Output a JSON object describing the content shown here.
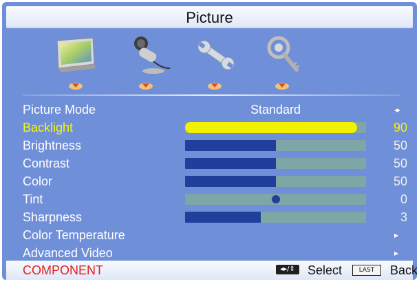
{
  "header": {
    "title": "Picture"
  },
  "menu_icons": [
    {
      "name": "picture-tv-icon"
    },
    {
      "name": "audio-microphone-icon"
    },
    {
      "name": "settings-wrench-icon"
    },
    {
      "name": "lock-key-icon"
    }
  ],
  "rows": [
    {
      "label": "Picture Mode",
      "kind": "option",
      "value": "Standard",
      "indicator": "◂▸"
    },
    {
      "label": "Backlight",
      "kind": "slider",
      "value": "90",
      "level": 0.95,
      "selected": true
    },
    {
      "label": "Brightness",
      "kind": "slider",
      "value": "50",
      "level": 0.5
    },
    {
      "label": "Contrast",
      "kind": "slider",
      "value": "50",
      "level": 0.5
    },
    {
      "label": "Color",
      "kind": "slider",
      "value": "50",
      "level": 0.5
    },
    {
      "label": "Tint",
      "kind": "center-slider",
      "value": "0",
      "level": 0.5
    },
    {
      "label": "Sharpness",
      "kind": "slider",
      "value": "3",
      "level": 0.42
    },
    {
      "label": "Color Temperature",
      "kind": "submenu",
      "indicator": "▸"
    },
    {
      "label": "Advanced Video",
      "kind": "submenu",
      "indicator": "▸"
    }
  ],
  "footer": {
    "source": "COMPONENT",
    "nav_icon_text": "◂▸/⇕",
    "select_label": "Select",
    "last_key": "LAST",
    "back_label": "Back"
  },
  "colors": {
    "panel": "#6f8fd8",
    "selected_text": "#f7f700",
    "slider_fill": "#1f3f9a",
    "slider_track": "#7fa6a6",
    "source_text": "#e02020"
  }
}
